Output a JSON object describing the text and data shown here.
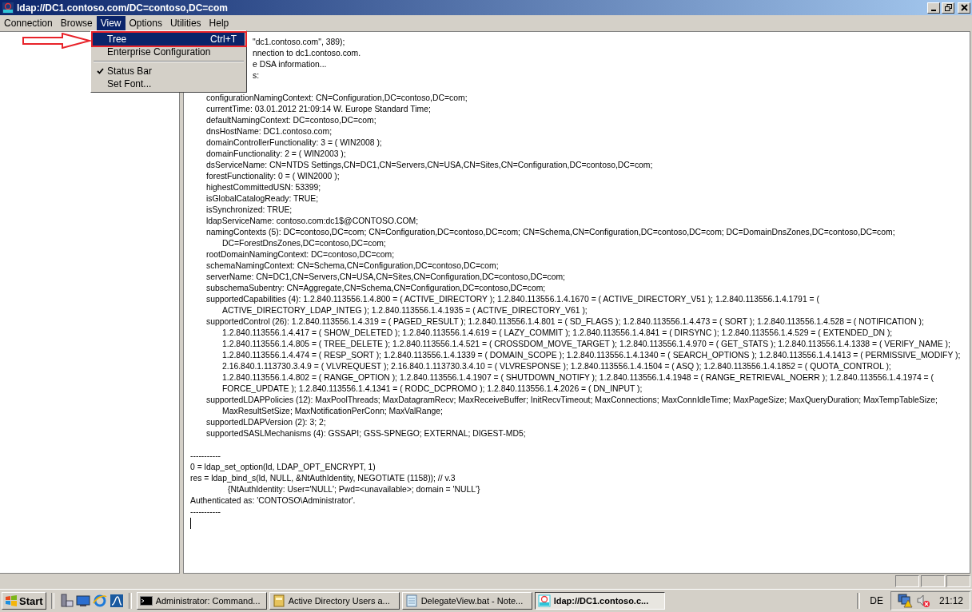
{
  "window": {
    "title": "ldap://DC1.contoso.com/DC=contoso,DC=com"
  },
  "menu_bar": [
    {
      "label": "Connection",
      "selected": false
    },
    {
      "label": "Browse",
      "selected": false
    },
    {
      "label": "View",
      "selected": true
    },
    {
      "label": "Options",
      "selected": false
    },
    {
      "label": "Utilities",
      "selected": false
    },
    {
      "label": "Help",
      "selected": false
    }
  ],
  "view_menu": [
    {
      "kind": "item",
      "label": "Tree",
      "shortcut": "Ctrl+T",
      "selected": true,
      "checked": false
    },
    {
      "kind": "item",
      "label": "Enterprise Configuration",
      "selected": false,
      "checked": false
    },
    {
      "kind": "separator"
    },
    {
      "kind": "item",
      "label": "Status Bar",
      "selected": false,
      "checked": true
    },
    {
      "kind": "item",
      "label": "Set Font...",
      "selected": false,
      "checked": false
    }
  ],
  "output": [
    {
      "kind": "covered",
      "text": "\"dc1.contoso.com\", 389);"
    },
    {
      "kind": "covered",
      "text": "nnection to dc1.contoso.com."
    },
    {
      "kind": "covered",
      "text": "e DSA information..."
    },
    {
      "kind": "covered",
      "text": "s:"
    },
    {
      "kind": "blank"
    },
    {
      "kind": "attr",
      "text": "configurationNamingContext: CN=Configuration,DC=contoso,DC=com;"
    },
    {
      "kind": "attr",
      "text": "currentTime: 03.01.2012 21:09:14 W. Europe Standard Time;"
    },
    {
      "kind": "attr",
      "text": "defaultNamingContext: DC=contoso,DC=com;"
    },
    {
      "kind": "attr",
      "text": "dnsHostName: DC1.contoso.com;"
    },
    {
      "kind": "attr",
      "text": "domainControllerFunctionality: 3 = ( WIN2008 );"
    },
    {
      "kind": "attr",
      "text": "domainFunctionality: 2 = ( WIN2003 );"
    },
    {
      "kind": "attr",
      "text": "dsServiceName: CN=NTDS Settings,CN=DC1,CN=Servers,CN=USA,CN=Sites,CN=Configuration,DC=contoso,DC=com;"
    },
    {
      "kind": "attr",
      "text": "forestFunctionality: 0 = ( WIN2000 );"
    },
    {
      "kind": "attr",
      "text": "highestCommittedUSN: 53399;"
    },
    {
      "kind": "attr",
      "text": "isGlobalCatalogReady: TRUE;"
    },
    {
      "kind": "attr",
      "text": "isSynchronized: TRUE;"
    },
    {
      "kind": "attr",
      "text": "ldapServiceName: contoso.com:dc1$@CONTOSO.COM;"
    },
    {
      "kind": "attr",
      "text": "namingContexts (5): DC=contoso,DC=com; CN=Configuration,DC=contoso,DC=com; CN=Schema,CN=Configuration,DC=contoso,DC=com; DC=DomainDnsZones,DC=contoso,DC=com;"
    },
    {
      "kind": "wrap",
      "text": "DC=ForestDnsZones,DC=contoso,DC=com;"
    },
    {
      "kind": "attr",
      "text": "rootDomainNamingContext: DC=contoso,DC=com;"
    },
    {
      "kind": "attr",
      "text": "schemaNamingContext: CN=Schema,CN=Configuration,DC=contoso,DC=com;"
    },
    {
      "kind": "attr",
      "text": "serverName: CN=DC1,CN=Servers,CN=USA,CN=Sites,CN=Configuration,DC=contoso,DC=com;"
    },
    {
      "kind": "attr",
      "text": "subschemaSubentry: CN=Aggregate,CN=Schema,CN=Configuration,DC=contoso,DC=com;"
    },
    {
      "kind": "attr",
      "text": "supportedCapabilities (4): 1.2.840.113556.1.4.800 = ( ACTIVE_DIRECTORY ); 1.2.840.113556.1.4.1670 = ( ACTIVE_DIRECTORY_V51 ); 1.2.840.113556.1.4.1791 = ("
    },
    {
      "kind": "wrap",
      "text": "ACTIVE_DIRECTORY_LDAP_INTEG ); 1.2.840.113556.1.4.1935 = ( ACTIVE_DIRECTORY_V61 );"
    },
    {
      "kind": "attr",
      "text": "supportedControl (26): 1.2.840.113556.1.4.319 = ( PAGED_RESULT ); 1.2.840.113556.1.4.801 = ( SD_FLAGS ); 1.2.840.113556.1.4.473 = ( SORT ); 1.2.840.113556.1.4.528 = ( NOTIFICATION );"
    },
    {
      "kind": "wrap",
      "text": "1.2.840.113556.1.4.417 = ( SHOW_DELETED ); 1.2.840.113556.1.4.619 = ( LAZY_COMMIT ); 1.2.840.113556.1.4.841 = ( DIRSYNC ); 1.2.840.113556.1.4.529 = ( EXTENDED_DN );"
    },
    {
      "kind": "wrap",
      "text": "1.2.840.113556.1.4.805 = ( TREE_DELETE ); 1.2.840.113556.1.4.521 = ( CROSSDOM_MOVE_TARGET ); 1.2.840.113556.1.4.970 = ( GET_STATS ); 1.2.840.113556.1.4.1338 = ( VERIFY_NAME );"
    },
    {
      "kind": "wrap",
      "text": "1.2.840.113556.1.4.474 = ( RESP_SORT ); 1.2.840.113556.1.4.1339 = ( DOMAIN_SCOPE ); 1.2.840.113556.1.4.1340 = ( SEARCH_OPTIONS ); 1.2.840.113556.1.4.1413 = ( PERMISSIVE_MODIFY );"
    },
    {
      "kind": "wrap",
      "text": "2.16.840.1.113730.3.4.9 = ( VLVREQUEST ); 2.16.840.1.113730.3.4.10 = ( VLVRESPONSE ); 1.2.840.113556.1.4.1504 = ( ASQ ); 1.2.840.113556.1.4.1852 = ( QUOTA_CONTROL );"
    },
    {
      "kind": "wrap",
      "text": "1.2.840.113556.1.4.802 = ( RANGE_OPTION ); 1.2.840.113556.1.4.1907 = ( SHUTDOWN_NOTIFY ); 1.2.840.113556.1.4.1948 = ( RANGE_RETRIEVAL_NOERR ); 1.2.840.113556.1.4.1974 = ("
    },
    {
      "kind": "wrap",
      "text": "FORCE_UPDATE ); 1.2.840.113556.1.4.1341 = ( RODC_DCPROMO ); 1.2.840.113556.1.4.2026 = ( DN_INPUT );"
    },
    {
      "kind": "attr",
      "text": "supportedLDAPPolicies (12): MaxPoolThreads; MaxDatagramRecv; MaxReceiveBuffer; InitRecvTimeout; MaxConnections; MaxConnIdleTime; MaxPageSize; MaxQueryDuration; MaxTempTableSize;"
    },
    {
      "kind": "wrap",
      "text": "MaxResultSetSize; MaxNotificationPerConn; MaxValRange;"
    },
    {
      "kind": "attr",
      "text": "supportedLDAPVersion (2): 3; 2;"
    },
    {
      "kind": "attr",
      "text": "supportedSASLMechanisms (4): GSSAPI; GSS-SPNEGO; EXTERNAL; DIGEST-MD5;"
    },
    {
      "kind": "blank"
    },
    {
      "kind": "root",
      "text": "-----------"
    },
    {
      "kind": "root",
      "text": "0 = ldap_set_option(ld, LDAP_OPT_ENCRYPT, 1)"
    },
    {
      "kind": "root",
      "text": "res = ldap_bind_s(ld, NULL, &NtAuthIdentity, NEGOTIATE (1158)); // v.3"
    },
    {
      "kind": "detail",
      "text": "{NtAuthIdentity: User='NULL'; Pwd=<unavailable>; domain = 'NULL'}"
    },
    {
      "kind": "root",
      "text": "Authenticated as: 'CONTOSO\\Administrator'."
    },
    {
      "kind": "root",
      "text": "-----------"
    },
    {
      "kind": "cursor"
    }
  ],
  "taskbar": {
    "start": "Start",
    "tasks": [
      {
        "label": "Administrator: Command...",
        "kind": "console",
        "selected": false
      },
      {
        "label": "Active Directory Users a...",
        "kind": "book",
        "selected": false
      },
      {
        "label": "DelegateView.bat - Note...",
        "kind": "notepad",
        "selected": false
      },
      {
        "label": "ldap://DC1.contoso.c...",
        "kind": "ldp",
        "selected": true
      }
    ],
    "language": "DE",
    "clock": "21:12"
  }
}
